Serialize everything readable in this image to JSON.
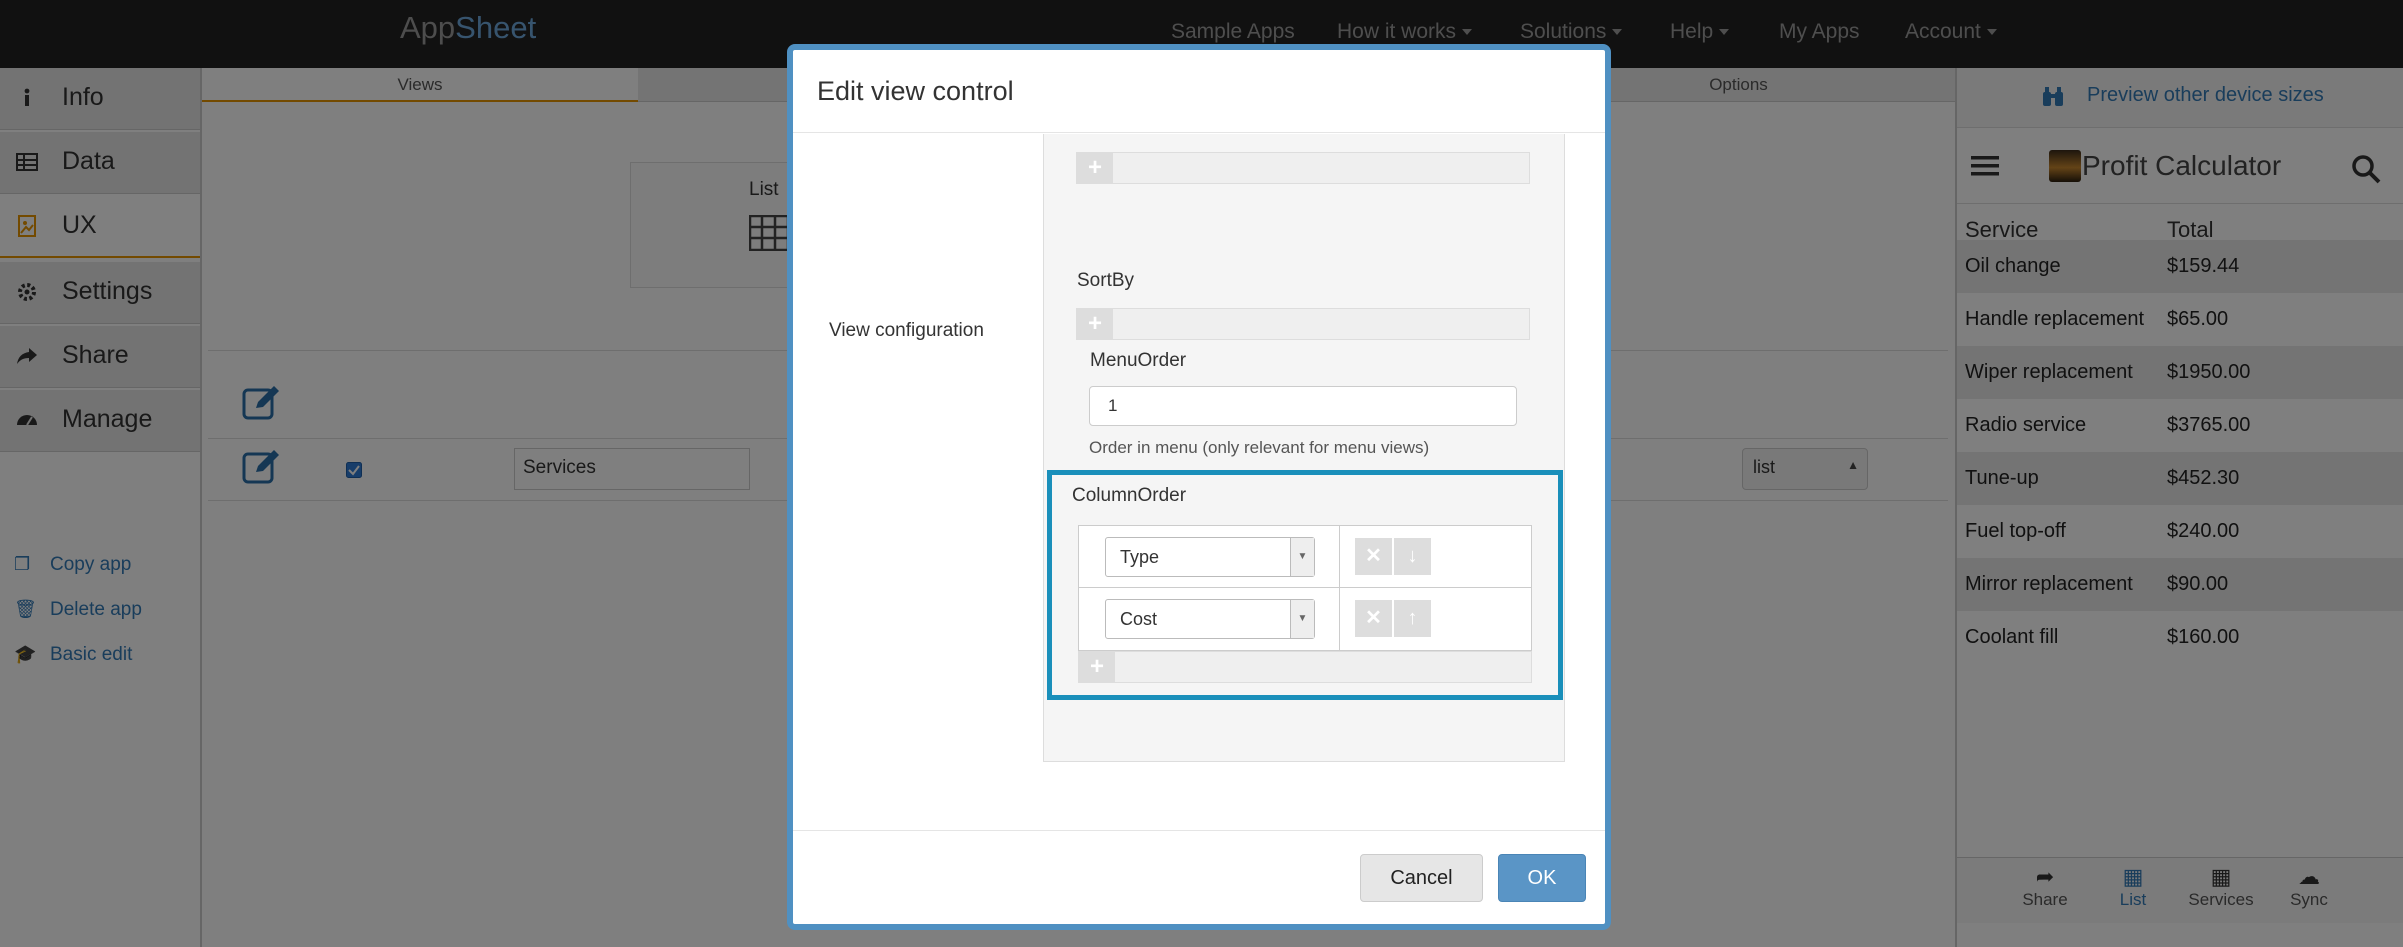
{
  "navbar": {
    "brand_app": "App",
    "brand_sheet": "Sheet",
    "links": {
      "sample_apps": "Sample Apps",
      "how_it_works": "How it works",
      "solutions": "Solutions",
      "help": "Help",
      "my_apps": "My Apps",
      "account": "Account"
    }
  },
  "sidebar": {
    "items": [
      {
        "label": "Info",
        "icon": "info-icon"
      },
      {
        "label": "Data",
        "icon": "table-icon"
      },
      {
        "label": "UX",
        "icon": "image-icon"
      },
      {
        "label": "Settings",
        "icon": "gear-icon"
      },
      {
        "label": "Share",
        "icon": "share-icon"
      },
      {
        "label": "Manage",
        "icon": "dashboard-icon"
      }
    ],
    "links": [
      {
        "label": "Copy app",
        "icon": "copy-icon"
      },
      {
        "label": "Delete app",
        "icon": "trash-icon"
      },
      {
        "label": "Basic edit",
        "icon": "graduation-cap-icon"
      }
    ]
  },
  "main": {
    "tabs": {
      "views": "Views",
      "options": "Options"
    },
    "view_card_label": "List",
    "row": {
      "name_value": "Services",
      "view_type": "list"
    }
  },
  "preview": {
    "device_link": "Preview other device sizes",
    "app_title": "Profit Calculator",
    "columns": {
      "service": "Service",
      "total": "Total"
    },
    "rows": [
      {
        "service": "Oil change",
        "total": "$159.44"
      },
      {
        "service": "Handle replacement",
        "total": "$65.00"
      },
      {
        "service": "Wiper replacement",
        "total": "$1950.00"
      },
      {
        "service": "Radio service",
        "total": "$3765.00"
      },
      {
        "service": "Tune-up",
        "total": "$452.30"
      },
      {
        "service": "Fuel top-off",
        "total": "$240.00"
      },
      {
        "service": "Mirror replacement",
        "total": "$90.00"
      },
      {
        "service": "Coolant fill",
        "total": "$160.00"
      }
    ],
    "bottom_nav": {
      "share": "Share",
      "list": "List",
      "services": "Services",
      "sync": "Sync"
    }
  },
  "modal": {
    "title": "Edit view control",
    "view_configuration": "View configuration",
    "sortby_label": "SortBy",
    "menuorder_label": "MenuOrder",
    "menuorder_value": "1",
    "menuorder_help": "Order in menu (only relevant for menu views)",
    "columnorder_label": "ColumnOrder",
    "columnorder_items": [
      "Type",
      "Cost"
    ],
    "cancel": "Cancel",
    "ok": "OK"
  },
  "colors": {
    "navbar_bg": "#222222",
    "brand_accent": "#6fa8dc",
    "link_blue": "#337ab7",
    "active_tab_underline": "#e69500",
    "highlight_border": "#1a8fba",
    "ok_button": "#5a95c6"
  }
}
